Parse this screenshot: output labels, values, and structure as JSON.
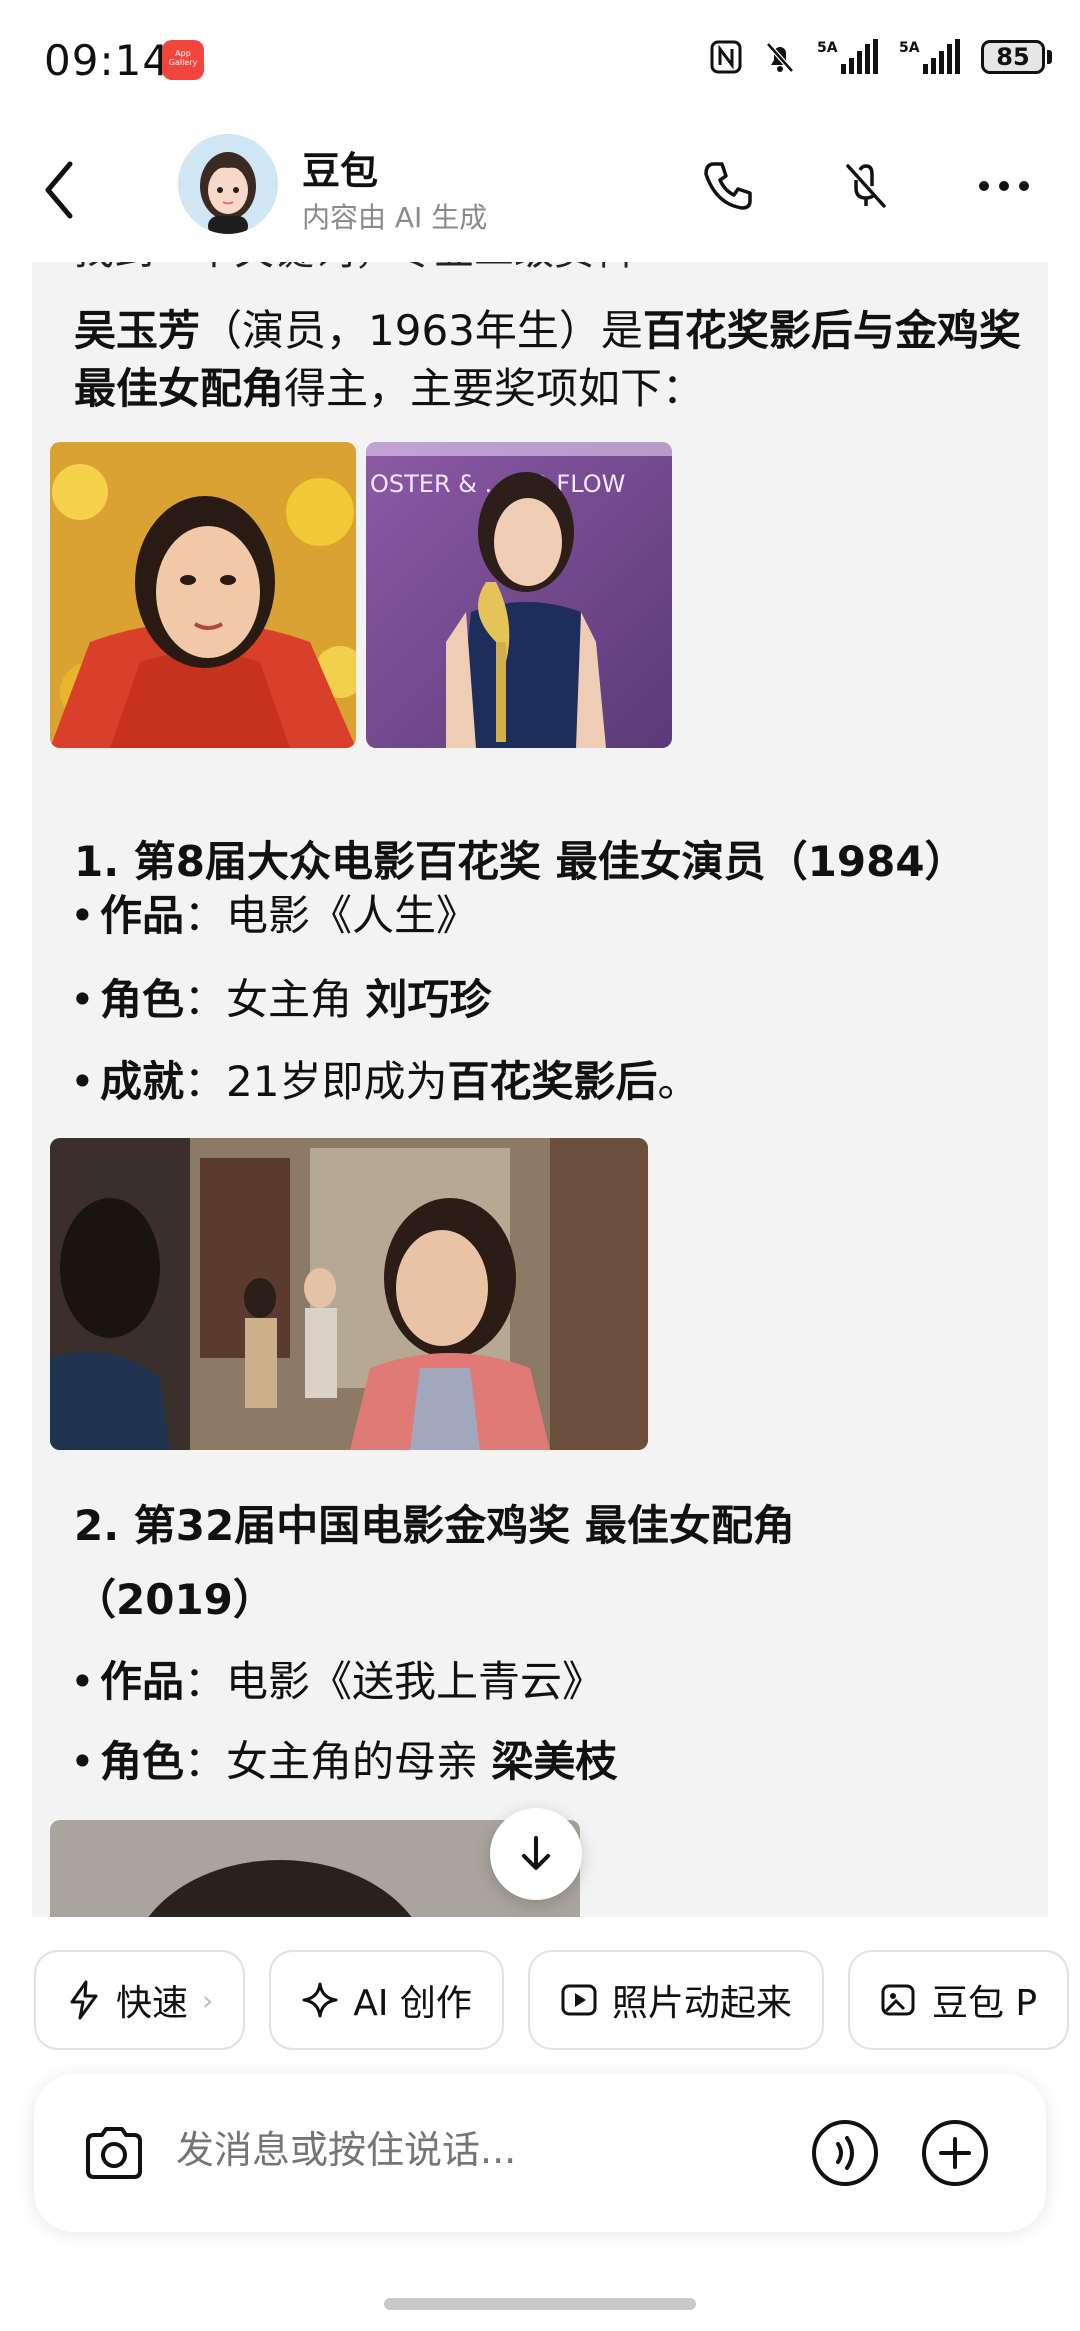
{
  "status": {
    "time": "09:14",
    "gallery_badge": "App Gallery",
    "battery": "85",
    "signal1_label": "5A",
    "signal2_label": "5A"
  },
  "header": {
    "title": "豆包",
    "subtitle": "内容由 AI 生成"
  },
  "message": {
    "clipped_top_line": "找到一个关键词，专业二级资料",
    "intro_name": "吴玉芳",
    "intro_paren": "（演员，1963年生）是",
    "intro_bold1": "百花奖影后",
    "intro_mid": "与",
    "intro_bold2": "金鸡奖最佳女配角",
    "intro_tail": "得主，主要奖项如下：",
    "photo1_caption": "OSTER & ... ED FLOW",
    "section1": {
      "title": "1. 第8届大众电影百花奖 最佳女演员（1984）",
      "work_key": "作品",
      "work_value": "：电影《人生》",
      "role_key": "角色",
      "role_value": "：女主角 ",
      "role_bold": "刘巧珍",
      "achieve_key": "成就",
      "achieve_value": "：21岁即成为",
      "achieve_bold": "百花奖影后",
      "achieve_tail": "。"
    },
    "section2": {
      "title_line1": "2. 第32届中国电影金鸡奖 最佳女配角",
      "title_line2": "（2019）",
      "work_key": "作品",
      "work_value": "：电影《送我上青云》",
      "role_key": "角色",
      "role_value": "：女主角的母亲 ",
      "role_bold": "梁美枝"
    }
  },
  "chips": [
    {
      "label": "快速",
      "suffix": "›"
    },
    {
      "label": "AI 创作"
    },
    {
      "label": "照片动起来"
    },
    {
      "label": "豆包 P"
    }
  ],
  "input": {
    "placeholder": "发消息或按住说话..."
  },
  "colors": {
    "bubble_bg": "#f3f3f3",
    "accent": "#111111",
    "badge": "#f2453d"
  }
}
